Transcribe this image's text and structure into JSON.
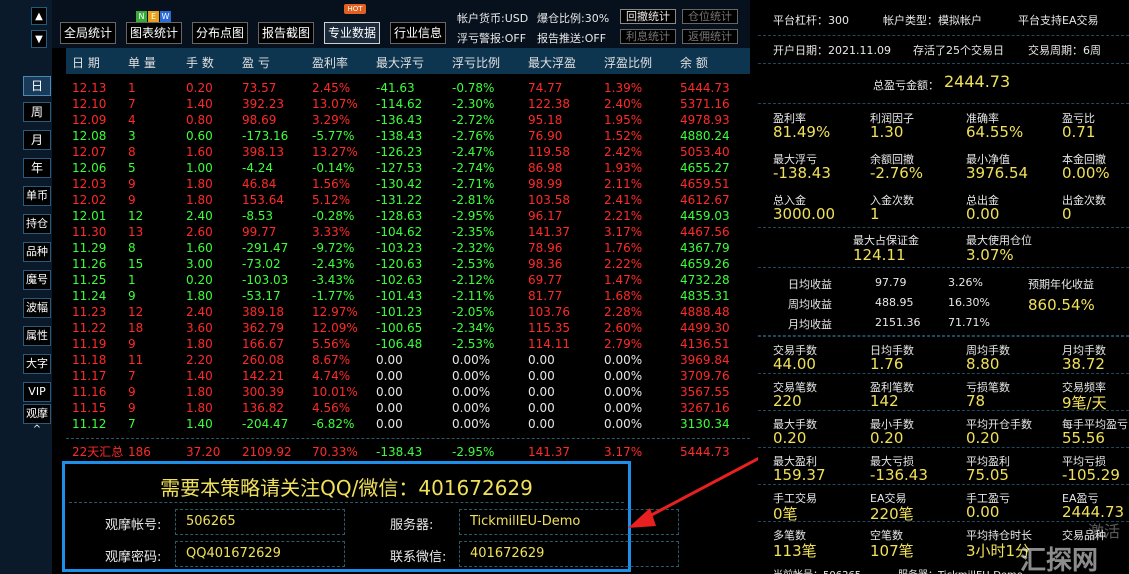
{
  "left_nav": {
    "items": [
      "日",
      "周",
      "月",
      "年",
      "单币",
      "持仓",
      "品种",
      "魔号",
      "波幅",
      "属性",
      "大字",
      "VIP",
      "观摩"
    ],
    "active_index": 0,
    "arrows": {
      "up": "▲",
      "down": "▼",
      "caret": "^"
    }
  },
  "toolbar": {
    "buttons": [
      {
        "label": "全局统计"
      },
      {
        "label": "图表统计"
      },
      {
        "label": "分布点图"
      },
      {
        "label": "报告截图"
      },
      {
        "label": "专业数据"
      },
      {
        "label": "行业信息"
      }
    ],
    "badges": {
      "n": "N",
      "e": "E",
      "w": "W",
      "hot": "HOT"
    },
    "info": {
      "currency": "帐户货币:USD",
      "margin_ratio": "爆仓比例:30%",
      "float_alert": "浮亏警报:OFF",
      "report_push": "报告推送:OFF"
    },
    "small_buttons": [
      {
        "label": "回撤统计",
        "enabled": true
      },
      {
        "label": "仓位统计",
        "enabled": false
      },
      {
        "label": "利息统计",
        "enabled": false
      },
      {
        "label": "返佣统计",
        "enabled": false
      }
    ]
  },
  "table": {
    "headers": [
      "日 期",
      "单 量",
      "手 数",
      "盈 亏",
      "盈利率",
      "最大浮亏",
      "浮亏比例",
      "最大浮盈",
      "浮盈比例",
      "余 额"
    ],
    "rows": [
      {
        "c": "red",
        "v": [
          "12.13",
          "1",
          "0.20",
          "73.57",
          "2.45%",
          "-41.63",
          "-0.78%",
          "74.77",
          "1.39%",
          "5444.73"
        ]
      },
      {
        "c": "red",
        "v": [
          "12.10",
          "7",
          "1.40",
          "392.23",
          "13.07%",
          "-114.62",
          "-2.30%",
          "122.38",
          "2.40%",
          "5371.16"
        ]
      },
      {
        "c": "red",
        "v": [
          "12.09",
          "4",
          "0.80",
          "98.69",
          "3.29%",
          "-136.43",
          "-2.72%",
          "95.18",
          "1.95%",
          "4978.93"
        ]
      },
      {
        "c": "green",
        "v": [
          "12.08",
          "3",
          "0.60",
          "-173.16",
          "-5.77%",
          "-138.43",
          "-2.76%",
          "76.90",
          "1.52%",
          "4880.24"
        ]
      },
      {
        "c": "red",
        "v": [
          "12.07",
          "8",
          "1.60",
          "398.13",
          "13.27%",
          "-126.23",
          "-2.47%",
          "119.58",
          "2.42%",
          "5053.40"
        ]
      },
      {
        "c": "green",
        "v": [
          "12.06",
          "5",
          "1.00",
          "-4.24",
          "-0.14%",
          "-127.53",
          "-2.74%",
          "86.98",
          "1.93%",
          "4655.27"
        ]
      },
      {
        "c": "red",
        "v": [
          "12.03",
          "9",
          "1.80",
          "46.84",
          "1.56%",
          "-130.42",
          "-2.71%",
          "98.99",
          "2.11%",
          "4659.51"
        ]
      },
      {
        "c": "red",
        "v": [
          "12.02",
          "9",
          "1.80",
          "153.64",
          "5.12%",
          "-131.22",
          "-2.81%",
          "103.58",
          "2.41%",
          "4612.67"
        ]
      },
      {
        "c": "green",
        "v": [
          "12.01",
          "12",
          "2.40",
          "-8.53",
          "-0.28%",
          "-128.63",
          "-2.95%",
          "96.17",
          "2.21%",
          "4459.03"
        ]
      },
      {
        "c": "red",
        "v": [
          "11.30",
          "13",
          "2.60",
          "99.77",
          "3.33%",
          "-104.62",
          "-2.35%",
          "141.37",
          "3.17%",
          "4467.56"
        ]
      },
      {
        "c": "green",
        "v": [
          "11.29",
          "8",
          "1.60",
          "-291.47",
          "-9.72%",
          "-103.23",
          "-2.32%",
          "78.96",
          "1.76%",
          "4367.79"
        ]
      },
      {
        "c": "green",
        "v": [
          "11.26",
          "15",
          "3.00",
          "-73.02",
          "-2.43%",
          "-120.63",
          "-2.53%",
          "98.36",
          "2.22%",
          "4659.26"
        ]
      },
      {
        "c": "green",
        "v": [
          "11.25",
          "1",
          "0.20",
          "-103.03",
          "-3.43%",
          "-102.63",
          "-2.12%",
          "69.77",
          "1.47%",
          "4732.28"
        ]
      },
      {
        "c": "green",
        "v": [
          "11.24",
          "9",
          "1.80",
          "-53.17",
          "-1.77%",
          "-101.43",
          "-2.11%",
          "81.77",
          "1.68%",
          "4835.31"
        ]
      },
      {
        "c": "red",
        "v": [
          "11.23",
          "12",
          "2.40",
          "389.18",
          "12.97%",
          "-101.23",
          "-2.05%",
          "103.76",
          "2.28%",
          "4888.48"
        ]
      },
      {
        "c": "red",
        "v": [
          "11.22",
          "18",
          "3.60",
          "362.79",
          "12.09%",
          "-100.65",
          "-2.34%",
          "115.35",
          "2.60%",
          "4499.30"
        ]
      },
      {
        "c": "red",
        "v": [
          "11.19",
          "9",
          "1.80",
          "166.67",
          "5.56%",
          "-106.48",
          "-2.53%",
          "114.11",
          "2.79%",
          "4136.51"
        ]
      },
      {
        "c": "red",
        "v": [
          "11.18",
          "11",
          "2.20",
          "260.08",
          "8.67%",
          "0.00",
          "0.00%",
          "0.00",
          "0.00%",
          "3969.84"
        ]
      },
      {
        "c": "red",
        "v": [
          "11.17",
          "7",
          "1.40",
          "142.21",
          "4.74%",
          "0.00",
          "0.00%",
          "0.00",
          "0.00%",
          "3709.76"
        ]
      },
      {
        "c": "red",
        "v": [
          "11.16",
          "9",
          "1.80",
          "300.39",
          "10.01%",
          "0.00",
          "0.00%",
          "0.00",
          "0.00%",
          "3567.55"
        ]
      },
      {
        "c": "red",
        "v": [
          "11.15",
          "9",
          "1.80",
          "136.82",
          "4.56%",
          "0.00",
          "0.00%",
          "0.00",
          "0.00%",
          "3267.16"
        ]
      },
      {
        "c": "green",
        "v": [
          "11.12",
          "7",
          "1.40",
          "-204.47",
          "-6.82%",
          "0.00",
          "0.00%",
          "0.00",
          "0.00%",
          "3130.34"
        ]
      }
    ],
    "summary": [
      "22天汇总",
      "186",
      "37.20",
      "2109.92",
      "70.33%",
      "-138.43",
      "-2.95%",
      "141.37",
      "3.17%",
      "5444.73"
    ]
  },
  "watch_box": {
    "headline": "需要本策略请关注QQ/微信：401672629",
    "account_label": "观摩帐号:",
    "account_value": "506265",
    "server_label": "服务器:",
    "server_value": "TickmillEU-Demo",
    "password_label": "观摩密码:",
    "password_value": "QQ401672629",
    "wechat_label": "联系微信:",
    "wechat_value": "401672629"
  },
  "right_panel": {
    "top": {
      "leverage": "平台杠杆：300",
      "account_type": "帐户类型：模拟帐户",
      "ea_support": "平台支持EA交易",
      "open_date": "开户日期：2021.11.09",
      "alive": "存活了25个交易日",
      "cycle": "交易周期：6周"
    },
    "total_profit_label": "总盈亏金额：",
    "total_profit_value": "2444.73",
    "stats1": [
      {
        "label": "盈利率",
        "value": "81.49%"
      },
      {
        "label": "利润因子",
        "value": "1.30"
      },
      {
        "label": "准确率",
        "value": "64.55%"
      },
      {
        "label": "盈亏比",
        "value": "0.71"
      },
      {
        "label": "最大浮亏",
        "value": "-138.43"
      },
      {
        "label": "余额回撤",
        "value": "-2.76%"
      },
      {
        "label": "最小净值",
        "value": "3976.54"
      },
      {
        "label": "本金回撤",
        "value": "0.00%"
      },
      {
        "label": "总入金",
        "value": "3000.00"
      },
      {
        "label": "入金次数",
        "value": "1"
      },
      {
        "label": "总出金",
        "value": "0.00"
      },
      {
        "label": "出金次数",
        "value": "0"
      }
    ],
    "margin": [
      {
        "label": "最大占保证金",
        "value": "124.11"
      },
      {
        "label": "最大使用仓位",
        "value": "3.07%"
      }
    ],
    "income": {
      "daily_label": "日均收益",
      "daily_value": "97.79",
      "daily_pct": "3.26%",
      "weekly_label": "周均收益",
      "weekly_value": "488.95",
      "weekly_pct": "16.30%",
      "monthly_label": "月均收益",
      "monthly_value": "2151.36",
      "monthly_pct": "71.71%",
      "annual_label": "预期年化收益",
      "annual_value": "860.54%"
    },
    "stats2": [
      {
        "label": "交易手数",
        "value": "44.00"
      },
      {
        "label": "日均手数",
        "value": "1.76"
      },
      {
        "label": "周均手数",
        "value": "8.80"
      },
      {
        "label": "月均手数",
        "value": "38.72"
      },
      {
        "label": "交易笔数",
        "value": "220"
      },
      {
        "label": "盈利笔数",
        "value": "142"
      },
      {
        "label": "亏损笔数",
        "value": "78"
      },
      {
        "label": "交易频率",
        "value": "9笔/天"
      },
      {
        "label": "最大手数",
        "value": "0.20"
      },
      {
        "label": "最小手数",
        "value": "0.20"
      },
      {
        "label": "平均开仓手数",
        "value": "0.20"
      },
      {
        "label": "每手平均盈亏",
        "value": "55.56"
      },
      {
        "label": "最大盈利",
        "value": "159.37"
      },
      {
        "label": "最大亏损",
        "value": "-136.43"
      },
      {
        "label": "平均盈利",
        "value": "75.05"
      },
      {
        "label": "平均亏损",
        "value": "-105.29"
      },
      {
        "label": "手工交易",
        "value": "0笔"
      },
      {
        "label": "EA交易",
        "value": "220笔"
      },
      {
        "label": "手工盈亏",
        "value": "0.00"
      },
      {
        "label": "EA盈亏",
        "value": "2444.73"
      },
      {
        "label": "多笔数",
        "value": "113笔"
      },
      {
        "label": "空笔数",
        "value": "107笔"
      },
      {
        "label": "平均持仓时长",
        "value": "3小时1分"
      },
      {
        "label": "交易品种",
        "value": ""
      }
    ],
    "footer": {
      "account": "当前帐号：506265",
      "server": "服务器：TickmillEU-Demo"
    },
    "watermark": {
      "activate": "激活",
      "brand": "汇探网"
    }
  },
  "colors": {
    "profit": "#ff2a2a",
    "loss": "#3cff3c",
    "value": "#f0e05a",
    "header_bg": "#0e3550",
    "highlight": "#1e8fe8"
  }
}
